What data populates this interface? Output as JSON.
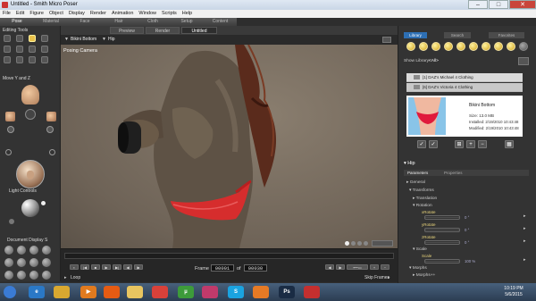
{
  "window": {
    "title": "Untitled - Smith Micro Poser",
    "minimize": "–",
    "maximize": "□",
    "close": "✕"
  },
  "menu": [
    "File",
    "Edit",
    "Figure",
    "Object",
    "Display",
    "Render",
    "Animation",
    "Window",
    "Scripts",
    "Help"
  ],
  "room_tabs": [
    "Pose",
    "Material",
    "Face",
    "Hair",
    "Cloth",
    "Setup",
    "Content"
  ],
  "left_panel": {
    "editing_tools_label": "Editing Tools",
    "move_label": "Move Y and Z",
    "light_controls_label": "Light Controls",
    "doc_display_label": "Document Display S"
  },
  "viewport": {
    "tabs": [
      "Preview",
      "Render",
      "Untitled"
    ],
    "figure_menu": "Bikini Bottom",
    "actor_menu": "Hip",
    "camera_label": "Posing Camera"
  },
  "timeline": {
    "frame_label": "Frame",
    "current_frame": "00001",
    "of_label": "of",
    "total_frames": "00030",
    "loop_label": "Loop",
    "skip_frames_label": "Skip Frames"
  },
  "library": {
    "tabs": [
      "Library",
      "Search",
      "Favorites"
    ],
    "show_library_label": "Show Library:",
    "show_library_value": "<All>",
    "folders": [
      {
        "count": "[1]",
        "name": "DAZ's Michael 4 Clothing"
      },
      {
        "count": "[6]",
        "name": "DAZ's Victoria 4 Clothing"
      }
    ],
    "preview": {
      "name": "Bikini Bottom",
      "size": "Size: 13.0 MB",
      "installed": "Installed: 2/19/2010 10:43:48",
      "modified": "Modified: 2/19/2010 10:43:48"
    }
  },
  "parameters": {
    "actor": "Hip",
    "tabs": [
      "Parameters",
      "Properties"
    ],
    "groups": [
      {
        "label": "General"
      },
      {
        "label": "Transforms"
      },
      {
        "label": "Translation"
      },
      {
        "label": "Rotation"
      },
      {
        "label": "Scale"
      },
      {
        "label": "Morphs"
      },
      {
        "label": "Morphs++"
      }
    ],
    "dials": [
      {
        "name": "xRotate",
        "value": "0 °"
      },
      {
        "name": "yRotate",
        "value": "0 °"
      },
      {
        "name": "zRotate",
        "value": "0 °"
      },
      {
        "name": "Scale",
        "value": "100 %"
      }
    ]
  },
  "taskbar": {
    "icons": [
      {
        "name": "start-orb-icon",
        "glyph": "",
        "color": "#3a7bd5"
      },
      {
        "name": "ie-icon",
        "glyph": "e",
        "color": "#2a78c6"
      },
      {
        "name": "explorer-icon",
        "glyph": "",
        "color": "#d9a830"
      },
      {
        "name": "media-player-icon",
        "glyph": "▶",
        "color": "#e07a1f"
      },
      {
        "name": "firefox-icon",
        "glyph": "",
        "color": "#e55b13"
      },
      {
        "name": "folder-icon",
        "glyph": "",
        "color": "#e8c560"
      },
      {
        "name": "chrome-icon",
        "glyph": "",
        "color": "#d8413a"
      },
      {
        "name": "utorrent-icon",
        "glyph": "µ",
        "color": "#3d9b3a"
      },
      {
        "name": "app-grid-icon",
        "glyph": "",
        "color": "#c03a6b"
      },
      {
        "name": "skype-icon",
        "glyph": "S",
        "color": "#1aa3e0"
      },
      {
        "name": "blender-icon",
        "glyph": "",
        "color": "#e57a25"
      },
      {
        "name": "photoshop-icon",
        "glyph": "Ps",
        "color": "#1a2c44"
      },
      {
        "name": "poser-icon",
        "glyph": "",
        "color": "#c42f2f"
      }
    ],
    "time": "10:19 PM",
    "date": "5/6/2015"
  }
}
